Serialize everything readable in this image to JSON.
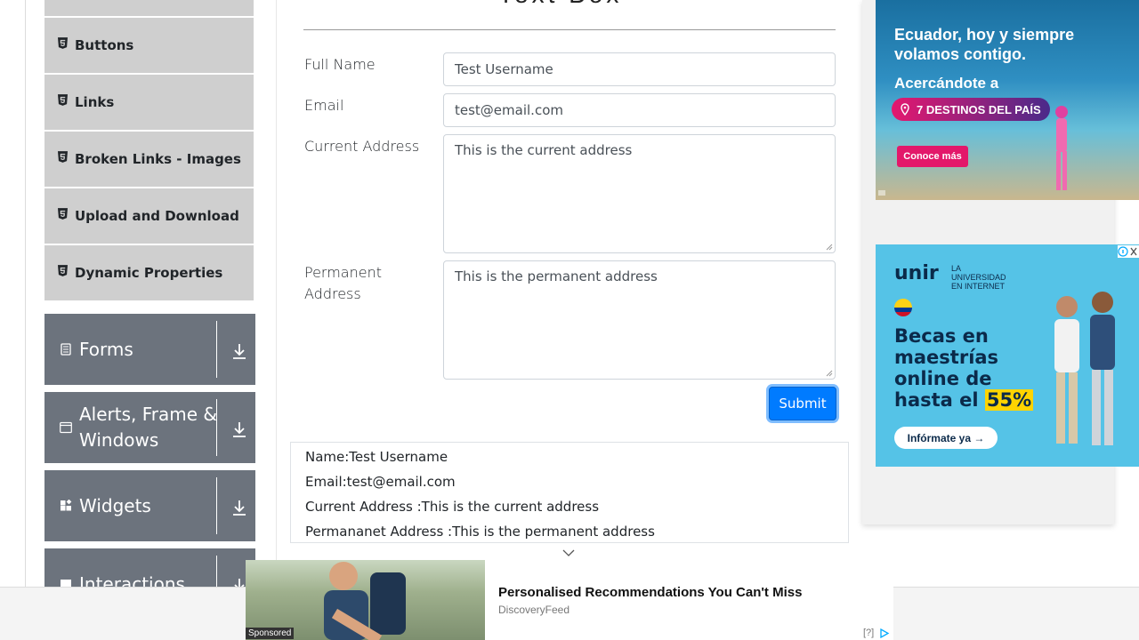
{
  "sidebar": {
    "sub_items": [
      {
        "label": ""
      },
      {
        "label": "Buttons"
      },
      {
        "label": "Links"
      },
      {
        "label": "Broken Links - Images"
      },
      {
        "label": "Upload and Download"
      },
      {
        "label": "Dynamic Properties"
      }
    ],
    "groups": [
      {
        "label": "Forms",
        "icon": "form-icon"
      },
      {
        "label": "Alerts, Frame & Windows",
        "icon": "window-icon"
      },
      {
        "label": "Widgets",
        "icon": "widgets-icon"
      },
      {
        "label": "Interactions",
        "icon": "interactions-icon"
      }
    ]
  },
  "form": {
    "heading": "Text Box",
    "full_name_label": "Full Name",
    "full_name_value": "Test Username",
    "email_label": "Email",
    "email_value": "test@email.com",
    "current_address_label": "Current Address",
    "current_address_value": "This is the current address",
    "permanent_address_label": "Permanent Address",
    "permanent_address_value": "This is the permanent address",
    "submit_label": "Submit"
  },
  "output": {
    "name": "Name:Test Username",
    "email": "Email:test@email.com",
    "current_address": "Current Address :This is the current address",
    "permanent_address": "Permananet Address :This is the permanent address"
  },
  "ads": {
    "ad1": {
      "line1": "Ecuador, hoy y siempre",
      "line2": "volamos contigo.",
      "line3": "Acercándote a",
      "pill": "7 DESTINOS DEL PAÍS",
      "button": "Conoce más"
    },
    "ad2": {
      "logo": "unir",
      "logo_sub": "LA UNIVERSIDAD EN INTERNET",
      "headline1": "Becas en",
      "headline2": "maestrías",
      "headline3": "online de",
      "headline4": "hasta el",
      "highlight": "55%",
      "cta": "Infórmate ya →"
    }
  },
  "sponsored": {
    "tag": "Sponsored",
    "title": "Personalised Recommendations You Can't Miss",
    "source": "DiscoveryFeed",
    "help": "[?]"
  },
  "colors": {
    "accent": "#007bff",
    "sidebar_group": "#6c737d",
    "sidebar_sub": "#cfcfcf"
  }
}
